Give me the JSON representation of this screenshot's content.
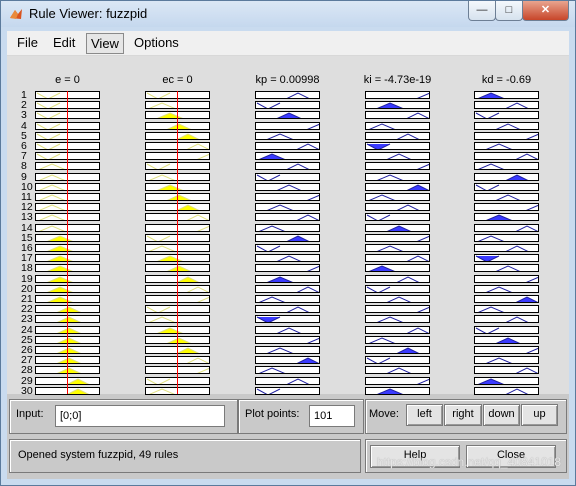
{
  "window": {
    "title": "Rule Viewer: fuzzpid"
  },
  "window_buttons": {
    "minimize": "—",
    "maximize": "□",
    "close": "✕"
  },
  "menu": [
    "File",
    "Edit",
    "View",
    "Options"
  ],
  "columns": [
    {
      "label": "e = 0",
      "kind": "input",
      "value": 0
    },
    {
      "label": "ec = 0",
      "kind": "input",
      "value": 0
    },
    {
      "label": "kp = 0.00998",
      "kind": "output",
      "value": 0.00998
    },
    {
      "label": "ki = -4.73e-19",
      "kind": "output",
      "value": -4.73e-19
    },
    {
      "label": "kd = -0.69",
      "kind": "output",
      "value": -0.69
    }
  ],
  "visible_rules": [
    1,
    2,
    3,
    4,
    5,
    6,
    7,
    8,
    9,
    10,
    11,
    12,
    13,
    14,
    15,
    16,
    17,
    18,
    19,
    20,
    21,
    22,
    23,
    24,
    25,
    26,
    27,
    28,
    29,
    30
  ],
  "input": {
    "label": "Input:",
    "value": "[0;0]"
  },
  "plot_points": {
    "label": "Plot points:",
    "value": "101"
  },
  "move": {
    "label": "Move:",
    "buttons": [
      "left",
      "right",
      "down",
      "up"
    ]
  },
  "status": {
    "text": "Opened system fuzzpid, 49 rules"
  },
  "actions": {
    "help": "Help",
    "close": "Close"
  },
  "watermark": "https://blog.csdn.net/qq_40841018",
  "colors": {
    "input_fill": "#ffff00",
    "output_fill": "#3a3aff",
    "input_line": "#e0e080",
    "output_line": "#2020a0",
    "marker": "#ff0000"
  }
}
